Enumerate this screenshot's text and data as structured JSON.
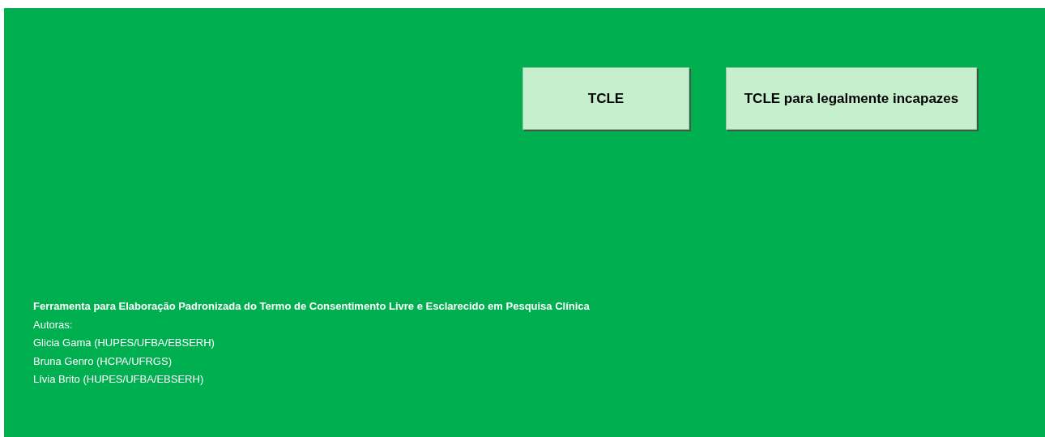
{
  "buttons": [
    {
      "label": "TCLE"
    },
    {
      "label": "TCLE para legalmente incapazes"
    }
  ],
  "footer": {
    "title": "Ferramenta para Elaboração Padronizada do Termo de Consentimento Livre e Esclarecido em Pesquisa Clínica",
    "lines": [
      "Autoras:",
      "Glicia Gama (HUPES/UFBA/EBSERH)",
      "Bruna Genro (HCPA/UFRGS)",
      "Lívia Brito (HUPES/UFBA/EBSERH)"
    ]
  }
}
